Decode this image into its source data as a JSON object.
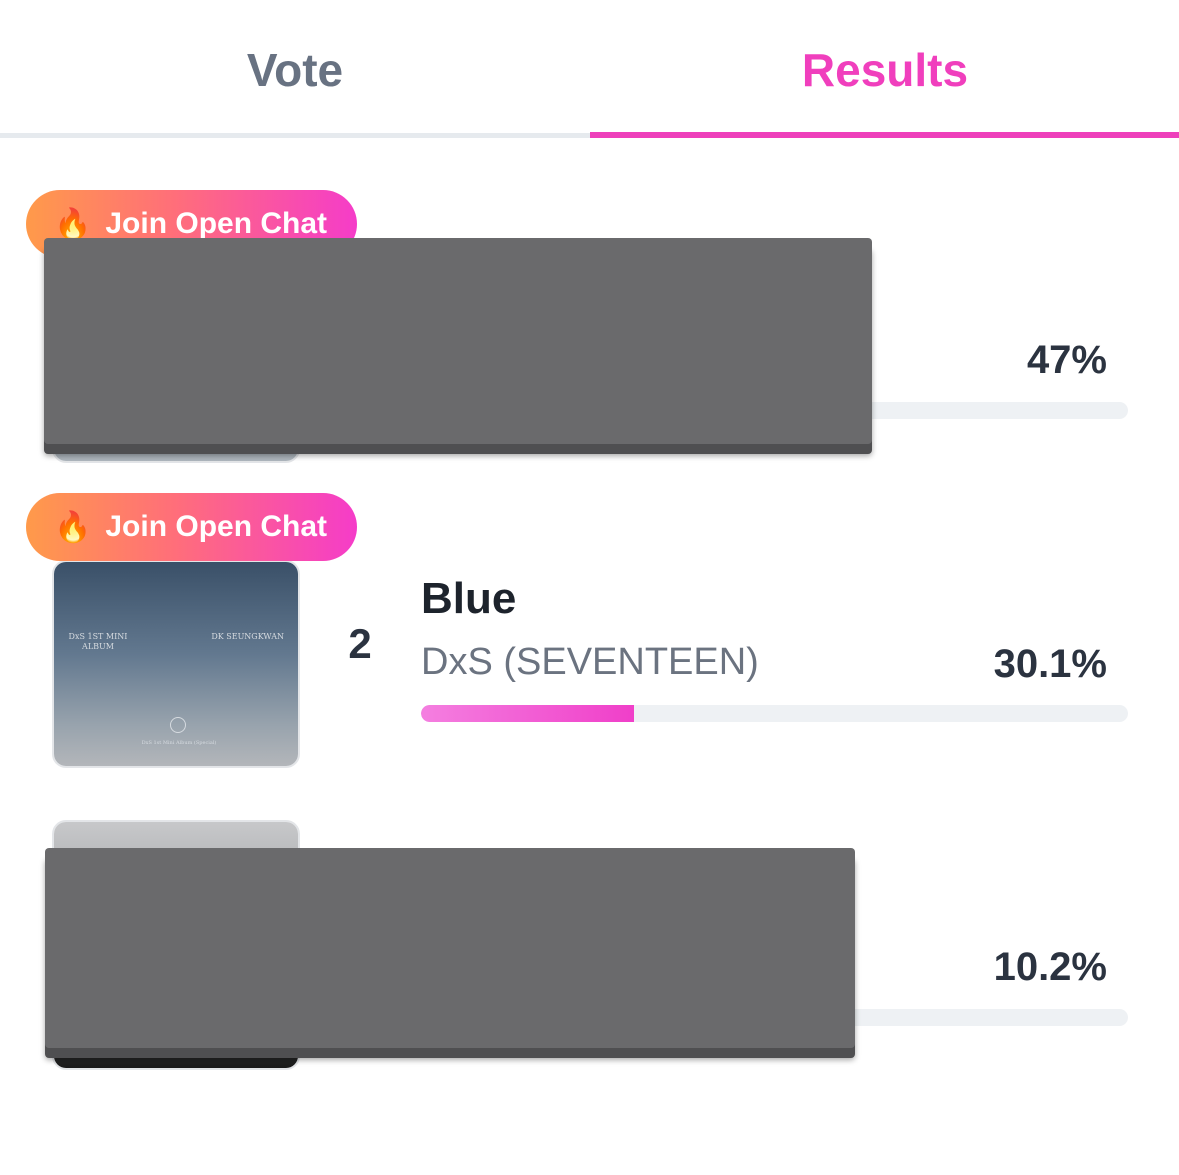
{
  "tabs": {
    "vote_label": "Vote",
    "results_label": "Results",
    "active": "results"
  },
  "badge": {
    "fire_icon": "🔥",
    "label": "Join Open Chat"
  },
  "results": [
    {
      "percent_label": "47%",
      "percent": 47
    },
    {
      "rank": "2",
      "title": "Blue",
      "artist": "DxS (SEVENTEEN)",
      "percent_label": "30.1%",
      "percent": 30.1,
      "album": {
        "left_text": "DxS 1ST MINI ALBUM",
        "right_text": "DK SEUNGKWAN",
        "bottom_text": "DxS 1st Mini Album (Special)"
      }
    },
    {
      "percent_label": "10.2%",
      "percent": 10.2
    }
  ],
  "colors": {
    "accent": "#f03fbd",
    "inactive_tab": "#687282",
    "track": "#eef1f4",
    "redaction": "#6a6a6c"
  }
}
